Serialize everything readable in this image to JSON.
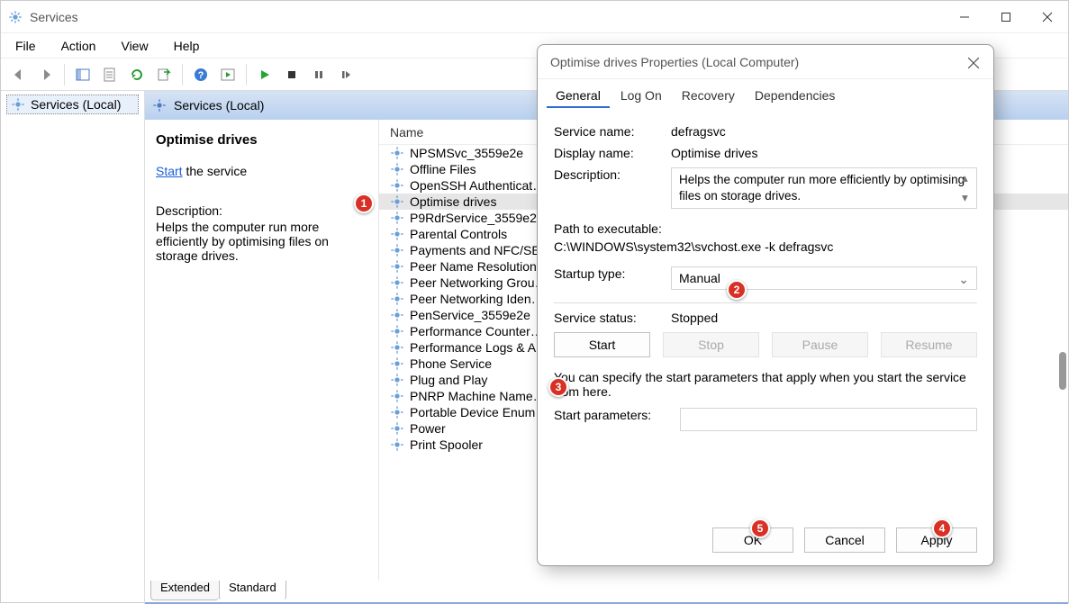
{
  "window": {
    "title": "Services"
  },
  "menubar": [
    "File",
    "Action",
    "View",
    "Help"
  ],
  "tree": {
    "root": "Services (Local)"
  },
  "mainHeader": "Services (Local)",
  "detail": {
    "heading": "Optimise drives",
    "startLink": "Start",
    "startSuffix": " the service",
    "descLabel": "Description:",
    "descText": "Helps the computer run more efficiently by optimising files on storage drives."
  },
  "list": {
    "header": "Name",
    "items": [
      "NPSMSvc_3559e2e",
      "Offline Files",
      "OpenSSH Authenticat…",
      "Optimise drives",
      "P9RdrService_3559e2e",
      "Parental Controls",
      "Payments and NFC/SE…",
      "Peer Name Resolution…",
      "Peer Networking Grou…",
      "Peer Networking Iden…",
      "PenService_3559e2e",
      "Performance Counter…",
      "Performance Logs & A…",
      "Phone Service",
      "Plug and Play",
      "PNRP Machine Name…",
      "Portable Device Enum…",
      "Power",
      "Print Spooler"
    ],
    "selectedIndex": 3
  },
  "footerTabs": {
    "extended": "Extended",
    "standard": "Standard"
  },
  "dialog": {
    "title": "Optimise drives Properties (Local Computer)",
    "tabs": [
      "General",
      "Log On",
      "Recovery",
      "Dependencies"
    ],
    "fields": {
      "serviceNameLabel": "Service name:",
      "serviceName": "defragsvc",
      "displayNameLabel": "Display name:",
      "displayName": "Optimise drives",
      "descriptionLabel": "Description:",
      "description": "Helps the computer run more efficiently by optimising files on storage drives.",
      "pathLabel": "Path to executable:",
      "path": "C:\\WINDOWS\\system32\\svchost.exe -k defragsvc",
      "startupTypeLabel": "Startup type:",
      "startupType": "Manual",
      "serviceStatusLabel": "Service status:",
      "serviceStatus": "Stopped",
      "paramsHint": "You can specify the start parameters that apply when you start the service from here.",
      "startParamsLabel": "Start parameters:"
    },
    "buttons": {
      "start": "Start",
      "stop": "Stop",
      "pause": "Pause",
      "resume": "Resume",
      "ok": "OK",
      "cancel": "Cancel",
      "apply": "Apply"
    }
  },
  "annotations": {
    "1": "1",
    "2": "2",
    "3": "3",
    "4": "4",
    "5": "5"
  }
}
